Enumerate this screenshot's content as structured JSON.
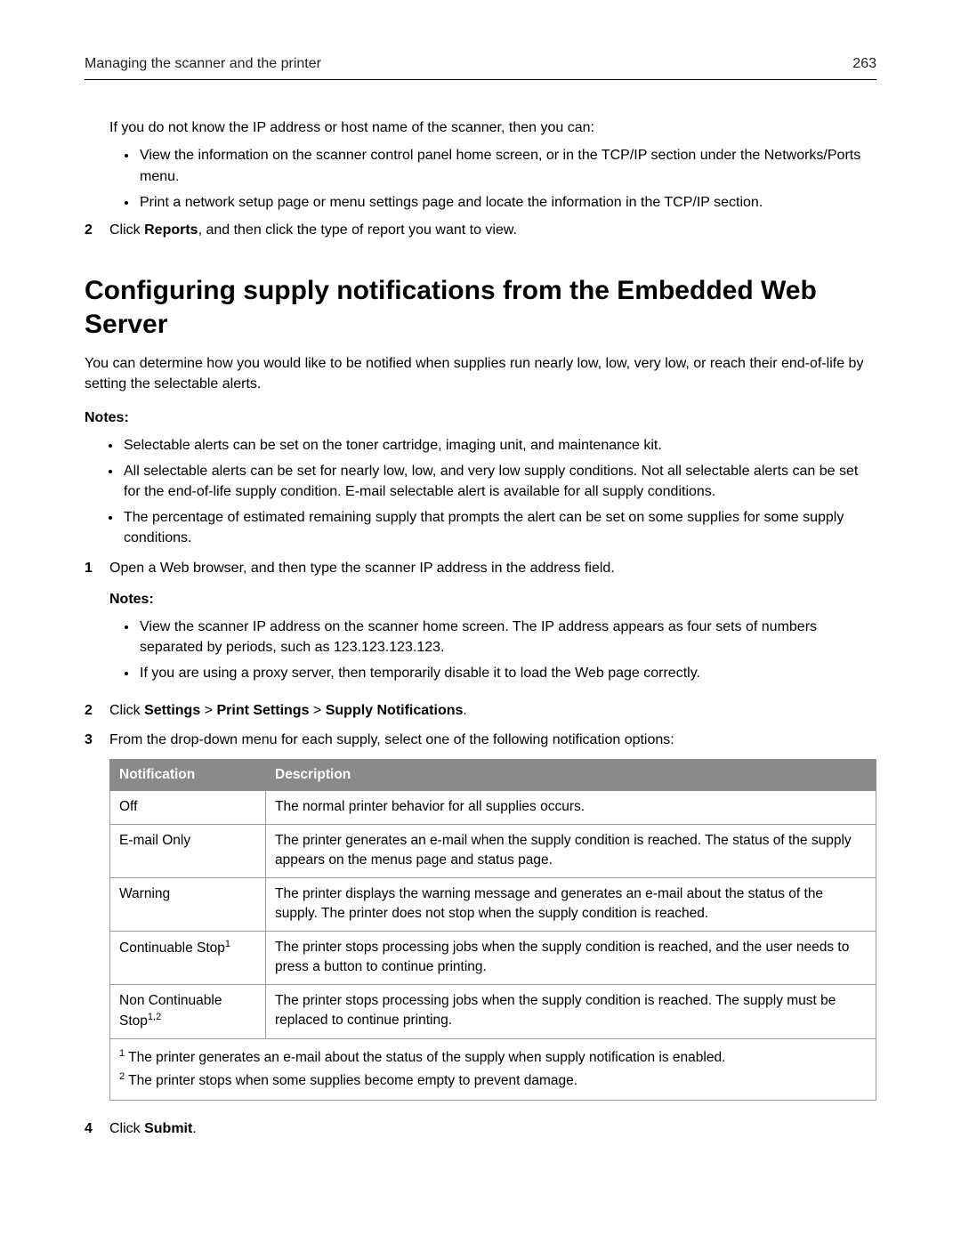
{
  "header": {
    "title": "Managing the scanner and the printer",
    "page": "263"
  },
  "top": {
    "intro": "If you do not know the IP address or host name of the scanner, then you can:",
    "bullets": [
      "View the information on the scanner control panel home screen, or in the TCP/IP section under the Networks/Ports menu.",
      "Print a network setup page or menu settings page and locate the information in the TCP/IP section."
    ],
    "step2_num": "2",
    "step2_a": "Click ",
    "step2_b": "Reports",
    "step2_c": ", and then click the type of report you want to view."
  },
  "section": {
    "heading": "Configuring supply notifications from the Embedded Web Server",
    "intro": "You can determine how you would like to be notified when supplies run nearly low, low, very low, or reach their end‑of‑life by setting the selectable alerts.",
    "notes_label": "Notes:",
    "notes": [
      "Selectable alerts can be set on the toner cartridge, imaging unit, and maintenance kit.",
      "All selectable alerts can be set for nearly low, low, and very low supply conditions. Not all selectable alerts can be set for the end‑of‑life supply condition. E‑mail selectable alert is available for all supply conditions.",
      "The percentage of estimated remaining supply that prompts the alert can be set on some supplies for some supply conditions."
    ],
    "steps": {
      "s1": {
        "num": "1",
        "text": "Open a Web browser, and then type the scanner IP address in the address field.",
        "sub_notes_label": "Notes:",
        "sub_notes": [
          "View the scanner IP address on the scanner home screen. The IP address appears as four sets of numbers separated by periods, such as 123.123.123.123.",
          "If you are using a proxy server, then temporarily disable it to load the Web page correctly."
        ]
      },
      "s2": {
        "num": "2",
        "a": "Click ",
        "b1": "Settings",
        "g1": " > ",
        "b2": "Print Settings",
        "g2": " > ",
        "b3": "Supply Notifications",
        "d": "."
      },
      "s3": {
        "num": "3",
        "text": "From the drop‑down menu for each supply, select one of the following notification options:"
      },
      "s4": {
        "num": "4",
        "a": "Click ",
        "b": "Submit",
        "c": "."
      }
    },
    "table": {
      "h1": "Notification",
      "h2": "Description",
      "rows": [
        {
          "n": "Off",
          "sup": "",
          "d": "The normal printer behavior for all supplies occurs."
        },
        {
          "n": "E‑mail Only",
          "sup": "",
          "d": "The printer generates an e‑mail when the supply condition is reached. The status of the supply appears on the menus page and status page."
        },
        {
          "n": "Warning",
          "sup": "",
          "d": "The printer displays the warning message and generates an e‑mail about the status of the supply. The printer does not stop when the supply condition is reached."
        },
        {
          "n": "Continuable Stop",
          "sup": "1",
          "d": "The printer stops processing jobs when the supply condition is reached, and the user needs to press a button to continue printing."
        },
        {
          "n": "Non Continuable Stop",
          "sup": "1,2",
          "d": "The printer stops processing jobs when the supply condition is reached. The supply must be replaced to continue printing."
        }
      ],
      "footnote1_sup": "1",
      "footnote1": " The printer generates an e‑mail about the status of the supply when supply notification is enabled.",
      "footnote2_sup": "2",
      "footnote2": " The printer stops when some supplies become empty to prevent damage."
    }
  }
}
